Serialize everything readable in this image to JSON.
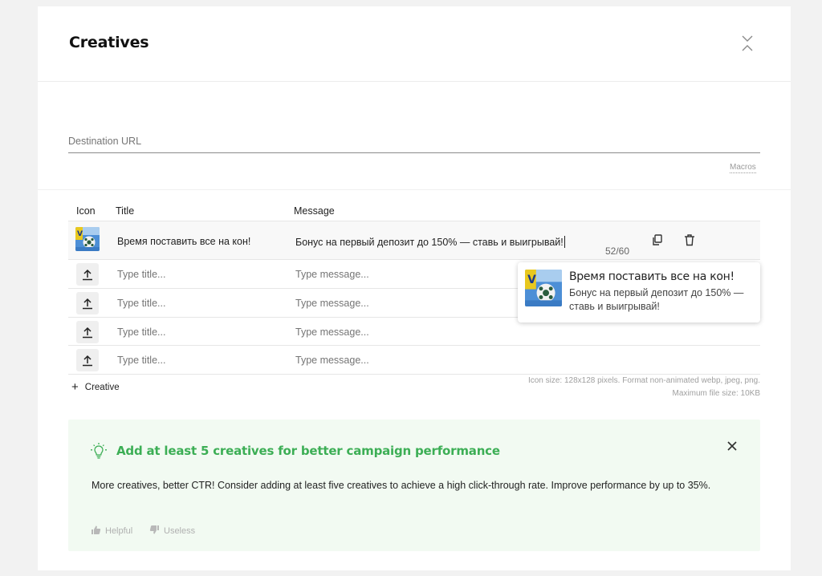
{
  "header": {
    "title": "Creatives"
  },
  "url": {
    "label": "Destination URL",
    "value": "",
    "macros_label": "Macros"
  },
  "table": {
    "headers": {
      "icon": "Icon",
      "title": "Title",
      "message": "Message"
    },
    "filled_row": {
      "title": "Время поставить все на кон!",
      "message": "Бонус на первый депозит до 150% — ставь и выигрывай!",
      "counter": "52/60"
    },
    "placeholders": {
      "title": "Type title...",
      "message": "Type message..."
    },
    "empty_row_count": 4
  },
  "add_creative_label": "Creative",
  "hint": {
    "line1": "Icon size: 128x128 pixels. Format non-animated webp, jpeg, png.",
    "line2": "Maximum file size: 10KB"
  },
  "preview": {
    "title": "Время поставить все на кон!",
    "message": "Бонус на первый депозит до 150% — ставь и выигрывай!"
  },
  "tip": {
    "title": "Add at least 5 creatives for better campaign performance",
    "text": "More creatives, better CTR! Consider adding at least five creatives to achieve a high click-through rate. Improve performance by up to 35%.",
    "helpful_label": "Helpful",
    "useless_label": "Useless"
  },
  "colors": {
    "accent_green": "#3cae55",
    "tip_bg": "#f2faf2"
  },
  "icons": [
    "collapse-icon",
    "upload-icon",
    "copy-icon",
    "trash-icon",
    "lightbulb-icon",
    "close-icon",
    "thumbs-up-icon",
    "thumbs-down-icon"
  ]
}
